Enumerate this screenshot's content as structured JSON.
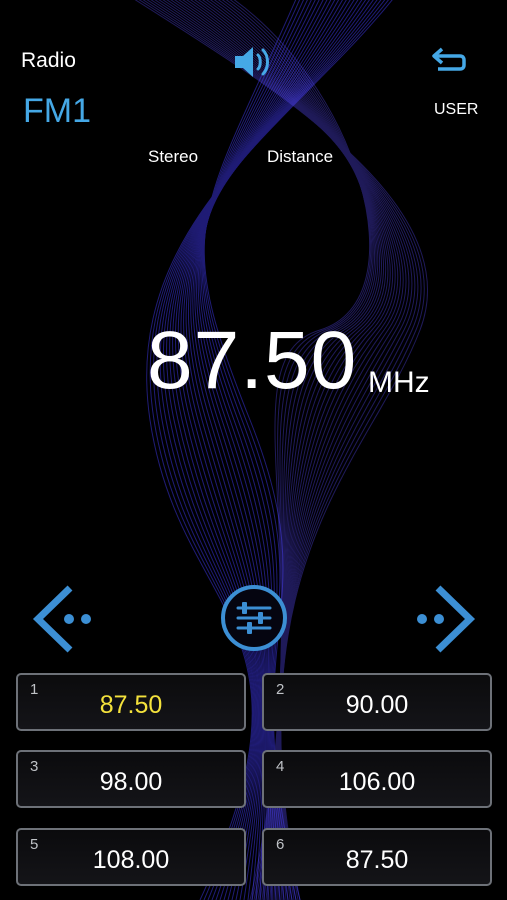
{
  "header": {
    "title": "Radio",
    "band": "FM1",
    "user_label": "USER"
  },
  "status": {
    "stereo_label": "Stereo",
    "distance_label": "Distance"
  },
  "display": {
    "frequency": "87.50",
    "unit": "MHz"
  },
  "controls": {
    "volume_icon": "volume-icon",
    "back_icon": "back-arrow-icon",
    "prev_icon": "seek-prev-icon",
    "next_icon": "seek-next-icon",
    "settings_icon": "equalizer-icon"
  },
  "presets": [
    {
      "num": "1",
      "value": "87.50",
      "active": true
    },
    {
      "num": "2",
      "value": "90.00",
      "active": false
    },
    {
      "num": "3",
      "value": "98.00",
      "active": false
    },
    {
      "num": "4",
      "value": "106.00",
      "active": false
    },
    {
      "num": "5",
      "value": "108.00",
      "active": false
    },
    {
      "num": "6",
      "value": "87.50",
      "active": false
    }
  ],
  "colors": {
    "accent": "#45a8e6",
    "active_preset": "#f4e23c",
    "wave": "#3a33d6"
  }
}
